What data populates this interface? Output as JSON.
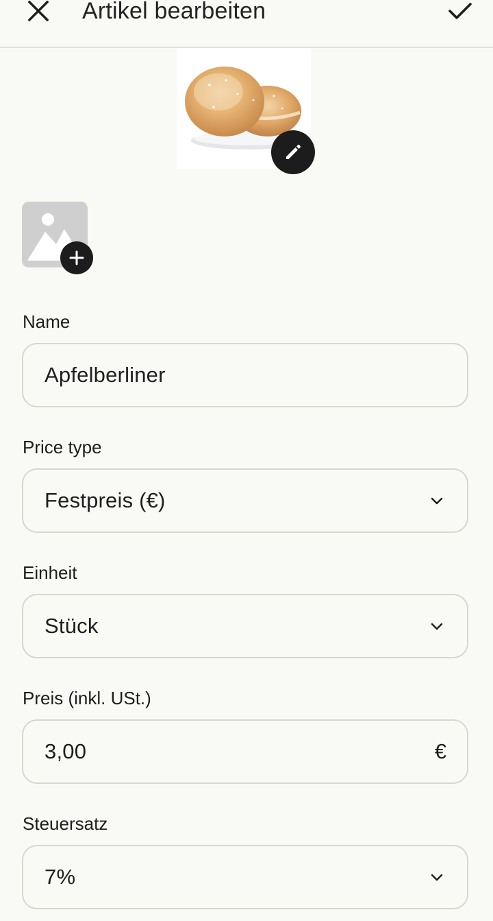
{
  "header": {
    "title": "Artikel bearbeiten",
    "close_icon": "close-icon",
    "confirm_icon": "check-icon"
  },
  "product_image": {
    "subject": "sugar-dusted berliner doughnuts on white plate",
    "edit_icon": "pencil-icon"
  },
  "add_image": {
    "icon": "image-placeholder-icon",
    "badge_icon": "plus-icon"
  },
  "form": {
    "name": {
      "label": "Name",
      "value": "Apfelberliner"
    },
    "price_type": {
      "label": "Price type",
      "value": "Festpreis (€)",
      "icon": "chevron-down-icon"
    },
    "unit": {
      "label": "Einheit",
      "value": "Stück",
      "icon": "chevron-down-icon"
    },
    "price": {
      "label": "Preis (inkl. USt.)",
      "value": "3,00",
      "suffix": "€"
    },
    "tax_rate": {
      "label": "Steuersatz",
      "value": "7%",
      "icon": "chevron-down-icon"
    }
  },
  "colors": {
    "background": "#f9f9f6",
    "field_border": "#d7d7d0",
    "dark_button": "#1c1c1c",
    "placeholder_tile": "#cfcfcf",
    "text": "#1a1a1a"
  }
}
